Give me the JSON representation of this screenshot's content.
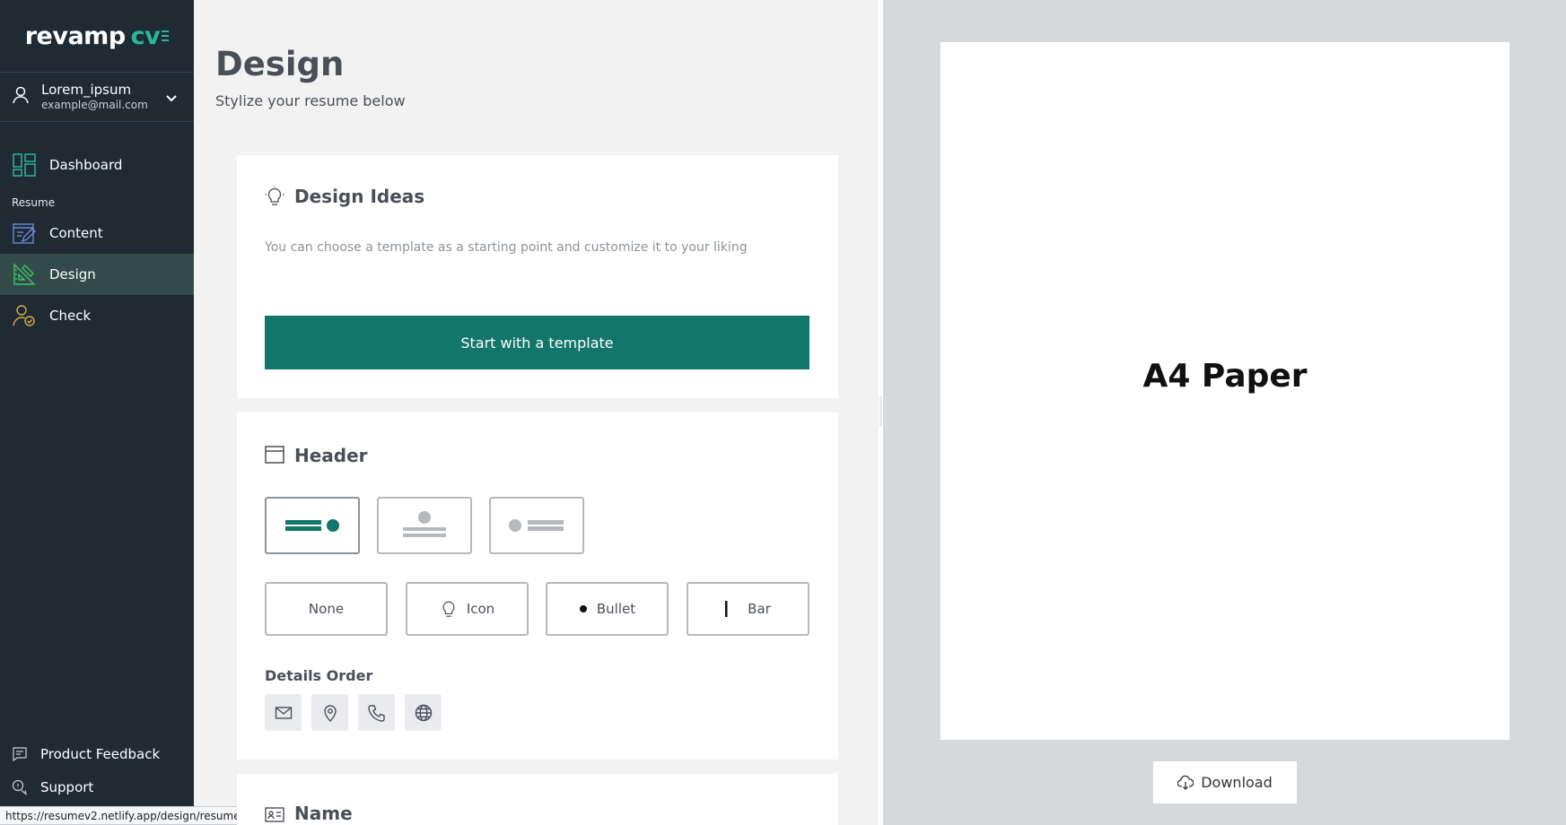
{
  "sidebar": {
    "logo_word": "revamp",
    "logo_cv": "cv",
    "user": {
      "name": "Lorem_ipsum",
      "email": "example@mail.com"
    },
    "items": {
      "dashboard": "Dashboard",
      "section_resume": "Resume",
      "content": "Content",
      "design": "Design",
      "check": "Check"
    },
    "bottom": {
      "feedback": "Product Feedback",
      "support": "Support"
    }
  },
  "status_url": "https://resumev2.netlify.app/design/resume",
  "main": {
    "title": "Design",
    "subtitle": "Stylize your resume below",
    "design_ideas": {
      "title": "Design Ideas",
      "text": "You can choose a template as a starting point and customize it to your liking",
      "button": "Start with a template"
    },
    "header": {
      "title": "Header",
      "styles": [
        "None",
        "Icon",
        "Bullet",
        "Bar"
      ],
      "details_order_label": "Details Order",
      "details_icons": [
        "mail-icon",
        "location-pin-icon",
        "phone-icon",
        "globe-icon"
      ]
    },
    "name_card": {
      "title": "Name"
    }
  },
  "preview": {
    "paper_label": "A4 Paper",
    "download": "Download"
  },
  "colors": {
    "accent": "#12766a",
    "sidebar_bg": "#1f2a33",
    "logo_green": "#2bb597",
    "active_bg": "#324a48"
  }
}
